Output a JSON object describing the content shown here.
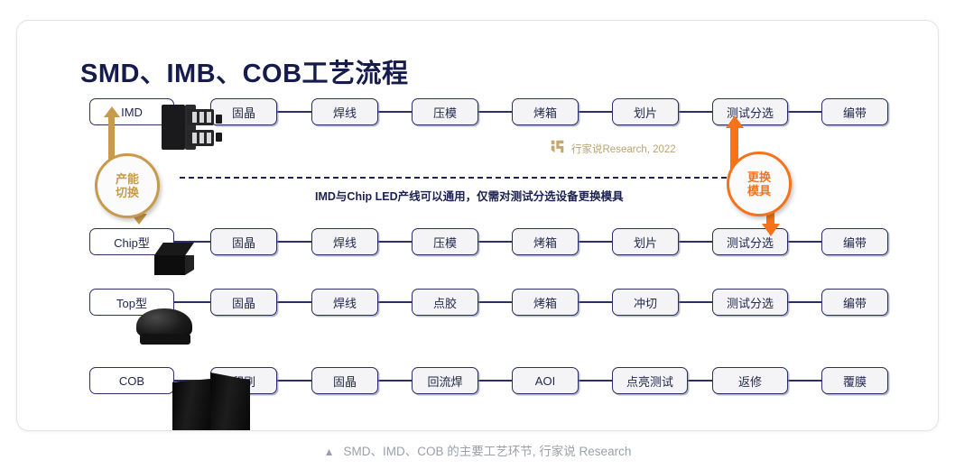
{
  "title": "SMD、IMB、COB工艺流程",
  "rows": [
    {
      "label": "IMD",
      "steps": [
        "固晶",
        "焊线",
        "压模",
        "烤箱",
        "划片",
        "测试分选",
        "编带"
      ]
    },
    {
      "label": "Chip型",
      "steps": [
        "固晶",
        "焊线",
        "压模",
        "烤箱",
        "划片",
        "测试分选",
        "编带"
      ]
    },
    {
      "label": "Top型",
      "steps": [
        "固晶",
        "焊线",
        "点胶",
        "烤箱",
        "冲切",
        "测试分选",
        "编带"
      ]
    },
    {
      "label": "COB",
      "steps": [
        "印刷",
        "固晶",
        "回流焊",
        "AOI",
        "点亮测试",
        "返修",
        "覆膜"
      ]
    }
  ],
  "badges": {
    "left": {
      "line1": "产能",
      "line2": "切换",
      "color": "#c79a4c"
    },
    "right": {
      "line1": "更换",
      "line2": "模具",
      "color": "#f4731c"
    }
  },
  "dashed_note": "IMD与Chip LED产线可以通用，仅需对测试分选设备更换模具",
  "watermark": {
    "text": "行家说Research, 2022",
    "icon": "brand-logo-icon",
    "color": "#b9a173"
  },
  "bottom_caption": {
    "marker": "▲",
    "text": "SMD、IMD、COB 的主要工艺环节, 行家说 Research"
  },
  "colors": {
    "title": "#161b4d",
    "box_border": "#2a2f66",
    "box_fill": "#f4f4f6",
    "accent_gold": "#c79a4c",
    "accent_orange": "#f4731c",
    "caption_gray": "#9aa0ab"
  }
}
